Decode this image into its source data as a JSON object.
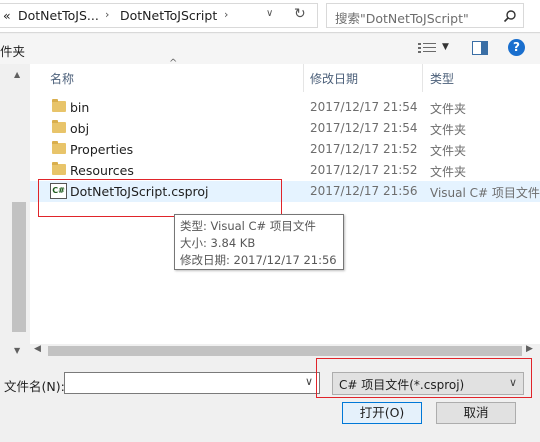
{
  "address": {
    "crumb_back": "«",
    "crumb_1": "DotNetToJS...",
    "crumb_2": "DotNetToJScript",
    "refresh_glyph": "↻",
    "search_placeholder": "搜索\"DotNetToJScript\""
  },
  "toolbar": {
    "left_label": "件夹",
    "view_icon": "view-details-icon",
    "help_label": "?"
  },
  "columns": {
    "name": "名称",
    "date": "修改日期",
    "type": "类型"
  },
  "files": [
    {
      "name": "bin",
      "date": "2017/12/17 21:54",
      "type": "文件夹",
      "icon": "folder-icon"
    },
    {
      "name": "obj",
      "date": "2017/12/17 21:54",
      "type": "文件夹",
      "icon": "folder-icon"
    },
    {
      "name": "Properties",
      "date": "2017/12/17 21:52",
      "type": "文件夹",
      "icon": "folder-icon"
    },
    {
      "name": "Resources",
      "date": "2017/12/17 21:52",
      "type": "文件夹",
      "icon": "folder-icon"
    },
    {
      "name": "DotNetToJScript.csproj",
      "date": "2017/12/17 21:56",
      "type": "Visual C# 项目文件",
      "icon": "csproj-icon"
    }
  ],
  "csproj_icon_label": "C#",
  "tooltip": {
    "type_line": "类型: Visual C# 项目文件",
    "size_line": "大小: 3.84 KB",
    "date_line": "修改日期: 2017/12/17 21:56"
  },
  "bottom": {
    "filename_label": "文件名(N):",
    "filename_value": "",
    "filetype_selected": "C# 项目文件(*.csproj)",
    "open_label": "打开(O)",
    "cancel_label": "取消"
  },
  "colors": {
    "highlight": "#e0242a",
    "help_blue": "#1a6fce",
    "header_text": "#4c607a"
  }
}
